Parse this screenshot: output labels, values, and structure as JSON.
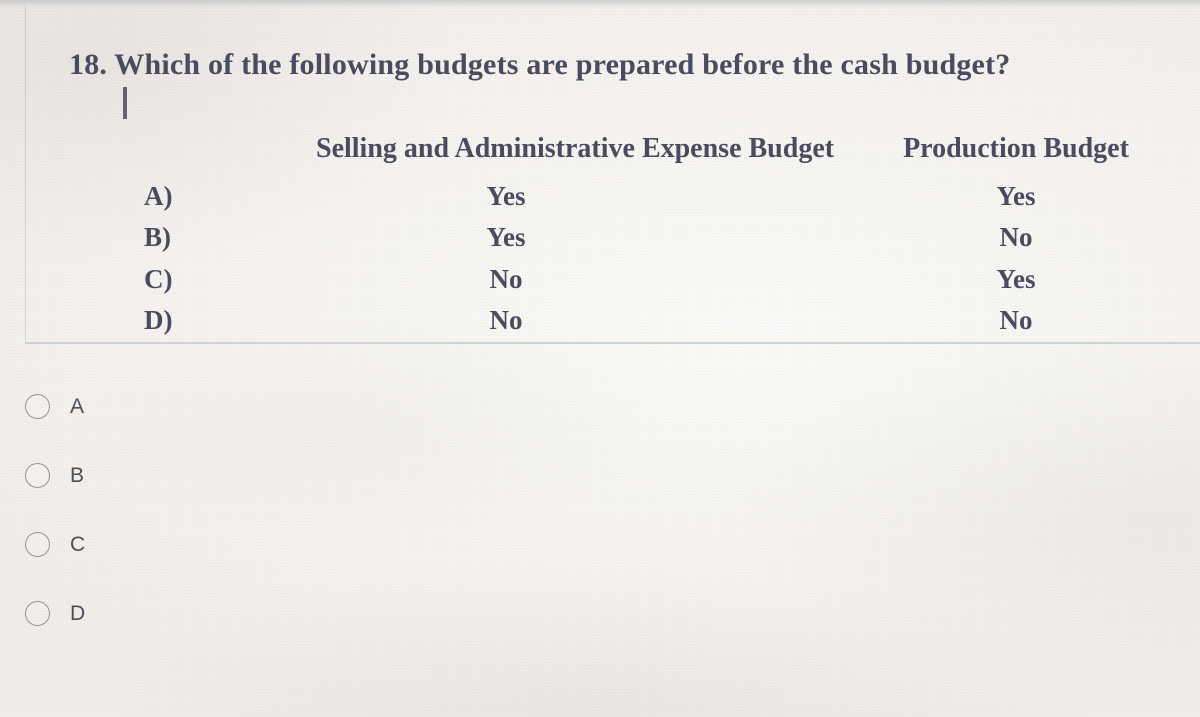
{
  "question": {
    "number": "18.",
    "stem": "Which of the following budgets are prepared before the cash budget?",
    "full_text": "18. Which of the following budgets are prepared before the cash budget?",
    "caret_visible": true
  },
  "answer_table": {
    "columns": [
      {
        "key": "letter",
        "header": ""
      },
      {
        "key": "selling_admin",
        "header": "Selling and Administrative Expense Budget"
      },
      {
        "key": "production",
        "header": "Production Budget"
      }
    ],
    "rows": [
      {
        "letter": "A)",
        "selling_admin": "Yes",
        "production": "Yes"
      },
      {
        "letter": "B)",
        "selling_admin": "Yes",
        "production": "No"
      },
      {
        "letter": "C)",
        "selling_admin": "No",
        "production": "Yes"
      },
      {
        "letter": "D)",
        "selling_admin": "No",
        "production": "No"
      }
    ]
  },
  "options": {
    "selected": null,
    "items": [
      {
        "value": "A",
        "label": "A",
        "selected": false
      },
      {
        "value": "B",
        "label": "B",
        "selected": false
      },
      {
        "value": "C",
        "label": "C",
        "selected": false
      },
      {
        "value": "D",
        "label": "D",
        "selected": false
      }
    ]
  },
  "colors": {
    "page_background": "#f3f0ed",
    "text": "#4b4b60",
    "option_label": "#4b4f58",
    "radio_border": "#9a9490",
    "block_border": "#a6bac6"
  }
}
